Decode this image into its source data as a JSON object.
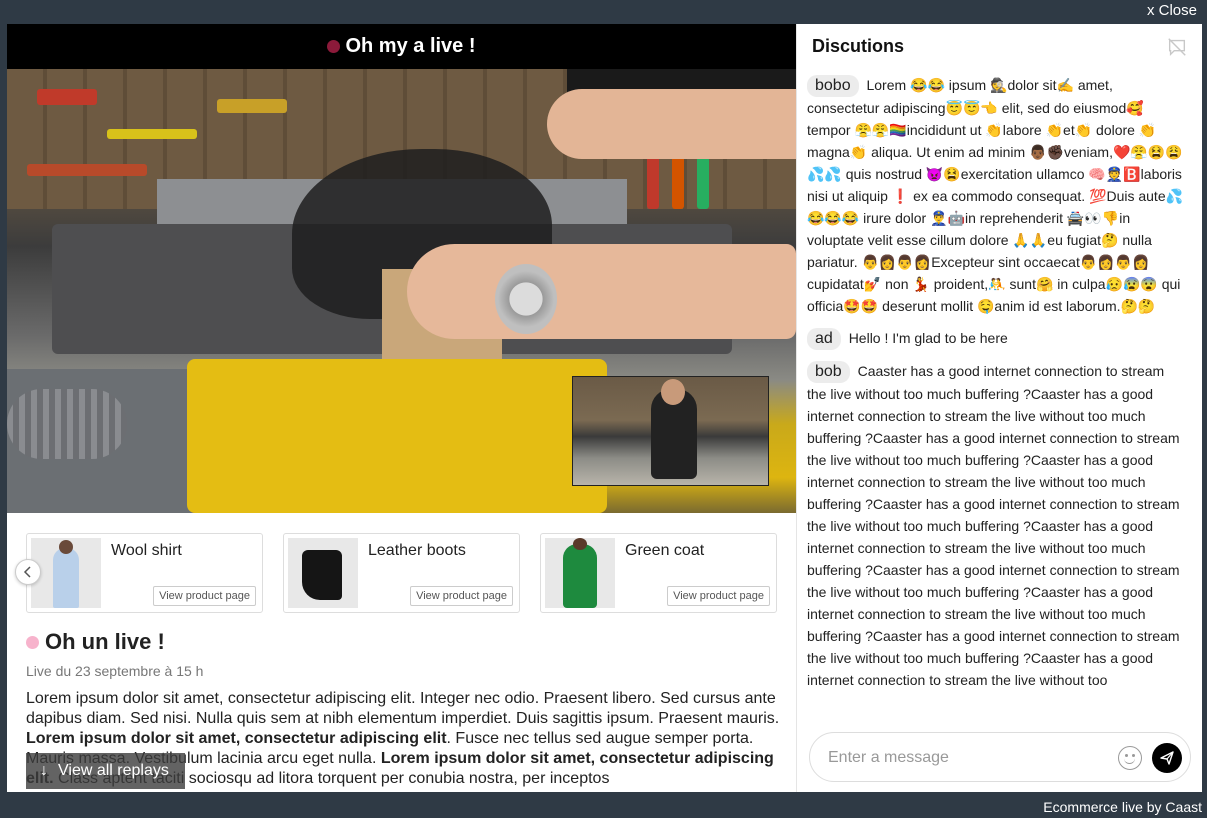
{
  "window": {
    "close_label": "x Close",
    "brand_footer": "Ecommerce live by Caast"
  },
  "live": {
    "header_title": "Oh my a live !",
    "dot_color": "#8b1a3a"
  },
  "products": [
    {
      "name": "Wool shirt",
      "cta": "View product page"
    },
    {
      "name": "Leather boots",
      "cta": "View product page"
    },
    {
      "name": "Green coat",
      "cta": "View product page"
    }
  ],
  "info": {
    "title": "Oh un live !",
    "date": "Live du 23 septembre à 15 h",
    "desc_1": "Lorem ipsum dolor sit amet, consectetur adipiscing elit. Integer nec odio. Praesent libero. Sed cursus ante dapibus diam. Sed nisi. Nulla quis sem at nibh elementum imperdiet. Duis sagittis ipsum. Praesent mauris. ",
    "desc_bold_1": "Lorem ipsum dolor sit amet, consectetur adipiscing elit",
    "desc_2": ". Fusce nec tellus sed augue semper porta. Mauris massa. Vestibulum lacinia arcu eget nulla. ",
    "desc_bold_2": "Lorem ipsum dolor sit amet, consectetur adipiscing elit.",
    "desc_3": " Class aptent taciti sociosqu ad litora torquent per conubia nostra, per inceptos",
    "replays_label": "View all replays",
    "dot_color": "#f7b3cc"
  },
  "chat": {
    "title": "Discutions",
    "messages": [
      {
        "author": "bobo",
        "text": "Lorem 😂😂 ipsum 🕵️dolor sit✍️ amet, consectetur adipiscing😇😇👈 elit, sed do eiusmod🥰 tempor 😤😤🏳️‍🌈incididunt ut 👏labore 👏et👏 dolore 👏magna👏 aliqua. Ut enim ad minim 👨🏾✊🏿veniam,❤️😤😫😩💦💦 quis nostrud 👿😫exercitation ullamco 🧠👮🅱️laboris nisi ut aliquip ❗ ex ea commodo consequat. 💯Duis aute💦😂😂😂 irure dolor 👮‍♂️🤖in reprehenderit 🚔👀👎in voluptate velit esse cillum dolore 🙏🙏eu fugiat🤔 nulla pariatur. 👨‍👩👨‍👩Excepteur sint occaecat👨‍👩👨‍👩 cupidatat💅 non 💃 proident,🤼 sunt🤗 in culpa😥😰😨 qui officia🤩🤩 deserunt mollit 🤤anim id est laborum.🤔🤔"
      },
      {
        "author": "ad",
        "text": "Hello ! I'm glad to be here"
      },
      {
        "author": "bob",
        "text": "Caaster has a good internet connection to stream the live without too much buffering ?Caaster has a good internet connection to stream the live without too much buffering ?Caaster has a good internet connection to stream the live without too much buffering ?Caaster has a good internet connection to stream the live without too much buffering ?Caaster has a good internet connection to stream the live without too much buffering ?Caaster has a good internet connection to stream the live without too much buffering ?Caaster has a good internet connection to stream the live without too much buffering ?Caaster has a good internet connection to stream the live without too much buffering ?Caaster has a good internet connection to stream the live without too much buffering ?Caaster has a good internet connection to stream the live without too"
      }
    ],
    "input_placeholder": "Enter a message"
  }
}
